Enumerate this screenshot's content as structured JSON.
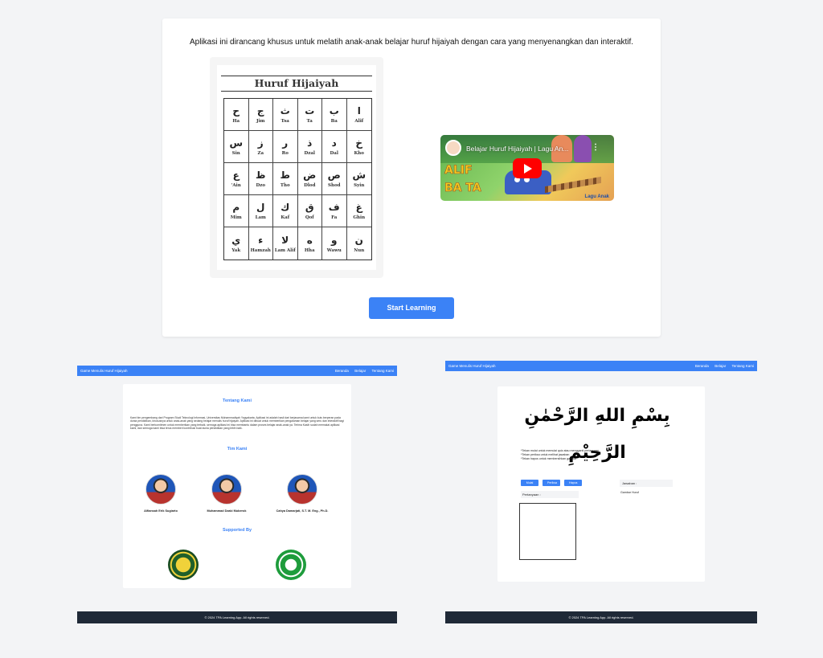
{
  "main": {
    "description": "Aplikasi ini dirancang khusus untuk melatih anak-anak belajar huruf hijaiyah dengan cara yang menyenangkan dan interaktif.",
    "chart_title": "Huruf Hijaiyah",
    "letters": [
      {
        "ar": "ح",
        "lat": "Ha"
      },
      {
        "ar": "ج",
        "lat": "Jim"
      },
      {
        "ar": "ث",
        "lat": "Tsa"
      },
      {
        "ar": "ت",
        "lat": "Ta"
      },
      {
        "ar": "ب",
        "lat": "Ba"
      },
      {
        "ar": "ا",
        "lat": "Alif"
      },
      {
        "ar": "س",
        "lat": "Sin"
      },
      {
        "ar": "ز",
        "lat": "Za"
      },
      {
        "ar": "ر",
        "lat": "Ro"
      },
      {
        "ar": "ذ",
        "lat": "Dzal"
      },
      {
        "ar": "د",
        "lat": "Dal"
      },
      {
        "ar": "خ",
        "lat": "Kho"
      },
      {
        "ar": "ع",
        "lat": "'Ain"
      },
      {
        "ar": "ظ",
        "lat": "Dzo"
      },
      {
        "ar": "ط",
        "lat": "Tho"
      },
      {
        "ar": "ض",
        "lat": "Dlod"
      },
      {
        "ar": "ص",
        "lat": "Shod"
      },
      {
        "ar": "ش",
        "lat": "Syin"
      },
      {
        "ar": "م",
        "lat": "Mim"
      },
      {
        "ar": "ل",
        "lat": "Lam"
      },
      {
        "ar": "ك",
        "lat": "Kaf"
      },
      {
        "ar": "ق",
        "lat": "Qof"
      },
      {
        "ar": "ف",
        "lat": "Fa"
      },
      {
        "ar": "غ",
        "lat": "Ghin"
      },
      {
        "ar": "ي",
        "lat": "Yak"
      },
      {
        "ar": "ء",
        "lat": "Hamzah"
      },
      {
        "ar": "لا",
        "lat": "Lam Alif"
      },
      {
        "ar": "ه",
        "lat": "Hha"
      },
      {
        "ar": "و",
        "lat": "Wawu"
      },
      {
        "ar": "ن",
        "lat": "Nun"
      }
    ],
    "video": {
      "title": "Belajar Huruf Hijaiyah | Lagu An...",
      "overlay_line1": "ALIF",
      "overlay_line2": "BA TA",
      "watermark": "Lagu Anak"
    },
    "start_label": "Start Learning"
  },
  "about_screen": {
    "nav_title": "Game Menulis Huruf Hijaiyah",
    "nav_links": [
      "Beranda",
      "Belajar",
      "Tentang Kami"
    ],
    "about_title": "Tentang Kami",
    "about_text": "Kami tim pengembang dari Program Studi Teknologi Informasi, Universitas Muhammadiyah Yogyakarta. Aplikasi ini adalah hasil dari kerjasama kami untuk kuis berperan pada dunia pendidikan, khususnya untuk anak-anak yang sedang belajar menulis huruf hijaiyah. Aplikasi ini dibuat untuk memberikan pengalaman belajar yang seru dan interaktif bagi pengguna. Kami berkomitmen untuk memberikan yang terbaik, semoga aplikasi ini bisa membantu dalam proses belajar anak-anak ya. Terima Kasih sudah memakai aplikasi kami, dan semoga kami bisa terus memberi kontribusi buat dunia pendidikan yang lebih baik.",
    "team_title": "Tim Kami",
    "members": [
      "Alfiansah Erik Sugiarto",
      "Muhammad Dzaki Muberok",
      "Cahya Damarjati, S.T. M. Eng., Ph.D."
    ],
    "supported_title": "Supported By",
    "footer": "© 2024 TPA Learning App. All rights reserved."
  },
  "write_screen": {
    "nav_title": "Game Menulis Huruf Hijaiyah",
    "nav_links": [
      "Beranda",
      "Belajar",
      "Tentang Kami"
    ],
    "bismillah": "بِسْمِ اللهِ الرَّحْمٰنِ الرَّحِيْمِ",
    "instructions": [
      "*Tekan mulai untuk memulai quiz atau mengganti pertanyaan",
      "*Tekan periksa untuk melihat jawaban",
      "*Tekan hapus untuk membersihkan gambar"
    ],
    "buttons": [
      "Mulai",
      "Periksa",
      "Hapus"
    ],
    "jawaban_label": "Jawaban :",
    "gambar_label": "Gambar Huruf",
    "pertanyaan_label": "Pertanyaan :",
    "footer": "© 2024 TPA Learning App. All rights reserved."
  }
}
